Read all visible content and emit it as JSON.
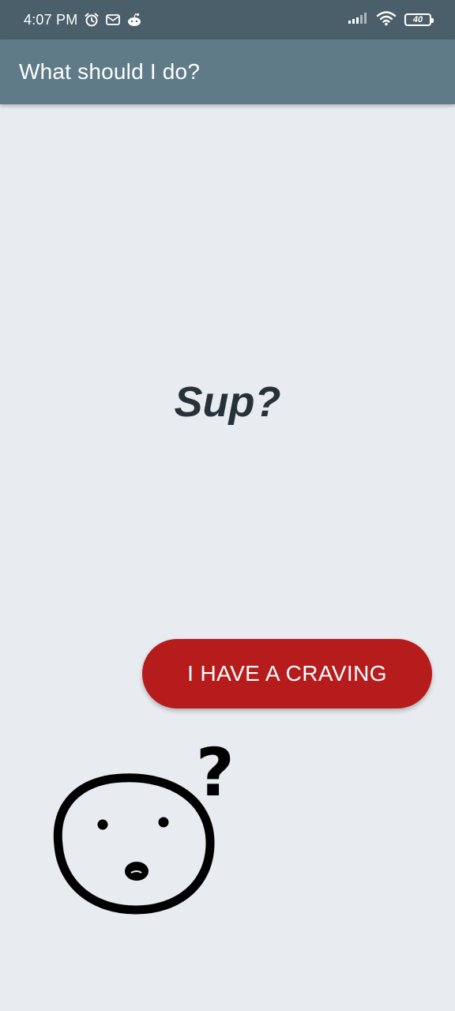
{
  "status_bar": {
    "time": "4:07 PM",
    "icons": [
      "alarm-icon",
      "mail-icon",
      "reddit-icon",
      "signal-icon",
      "wifi-icon",
      "battery-icon"
    ],
    "battery_level": "40"
  },
  "app_bar": {
    "title": "What should I do?"
  },
  "main": {
    "greeting": "Sup?",
    "craving_button_label": "I HAVE A CRAVING"
  },
  "illustration": {
    "name": "confused-face",
    "question_mark": "?"
  },
  "colors": {
    "status_bar": "#4b5f6b",
    "app_bar": "#5e7b87",
    "background": "#e8ecf0",
    "button": "#b71c1c",
    "greeting_text": "#263238"
  }
}
